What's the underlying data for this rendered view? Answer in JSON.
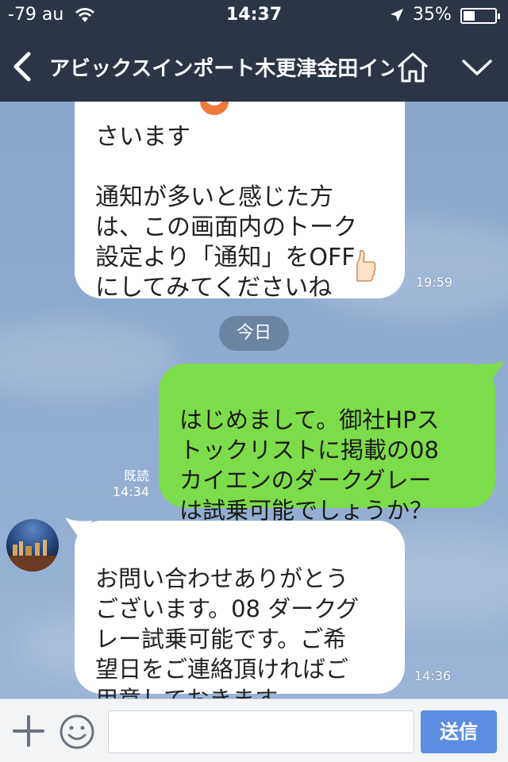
{
  "status_bar": {
    "carrier": "-79 au",
    "time": "14:37",
    "battery": "35%"
  },
  "header": {
    "title": "アビックスインポート木更津金田インター",
    "icons": [
      "back-arrow-icon",
      "home-icon",
      "chevron-down-icon"
    ]
  },
  "messages": [
    {
      "side": "left",
      "text": "さいます\n\n通知が多いと感じた方\nは、この画面内のトーク\n設定より「通知」をOFF\nにしてみてくださいね",
      "time": "19:59"
    },
    {
      "side": "right",
      "text": "はじめまして。御社HPス\nトックリストに掲載の08\nカイエンのダークグレー\nは試乗可能でしょうか？",
      "read": "既読",
      "time": "14:34"
    },
    {
      "side": "left",
      "text": "お問い合わせありがとう\nございます。08 ダークグ\nレー試乗可能です。ご希\n望日をご連絡頂ければご\n用意しておきます。",
      "time": "14:36"
    }
  ],
  "date_separator": "今日",
  "input_bar": {
    "placeholder": "",
    "send_label": "送信"
  },
  "colors": {
    "header_bg": "#2b3546",
    "chat_bg": "#8aa6cb",
    "incoming_bubble": "#ffffff",
    "outgoing_bubble": "#7ddc4a",
    "send_button": "#5b8de0"
  }
}
